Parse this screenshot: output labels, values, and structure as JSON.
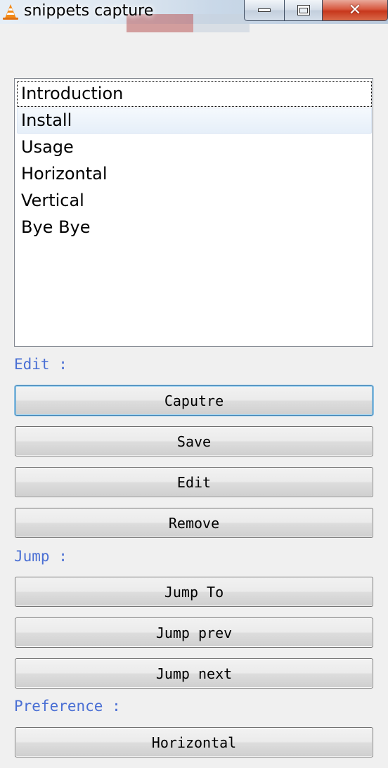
{
  "window": {
    "title": "snippets capture",
    "icon": "traffic-cone-icon",
    "controls": {
      "minimize": "minimize-icon",
      "maximize": "maximize-icon",
      "close": "close-icon"
    }
  },
  "list": {
    "items": [
      "Introduction",
      "Install",
      "Usage",
      "Horizontal",
      "Vertical",
      "Bye Bye"
    ],
    "focused_item": "Introduction",
    "hover_item": "Install"
  },
  "sections": {
    "edit": {
      "label": "Edit :",
      "buttons": [
        "Caputre",
        "Save",
        "Edit",
        "Remove"
      ]
    },
    "jump": {
      "label": "Jump :",
      "buttons": [
        "Jump To",
        "Jump prev",
        "Jump next"
      ]
    },
    "preference": {
      "label": "Preference :",
      "buttons": [
        "Horizontal"
      ]
    }
  },
  "colors": {
    "section_label": "#4a6fd4",
    "close_button": "#c7371c",
    "window_bg": "#f0f0f0"
  }
}
